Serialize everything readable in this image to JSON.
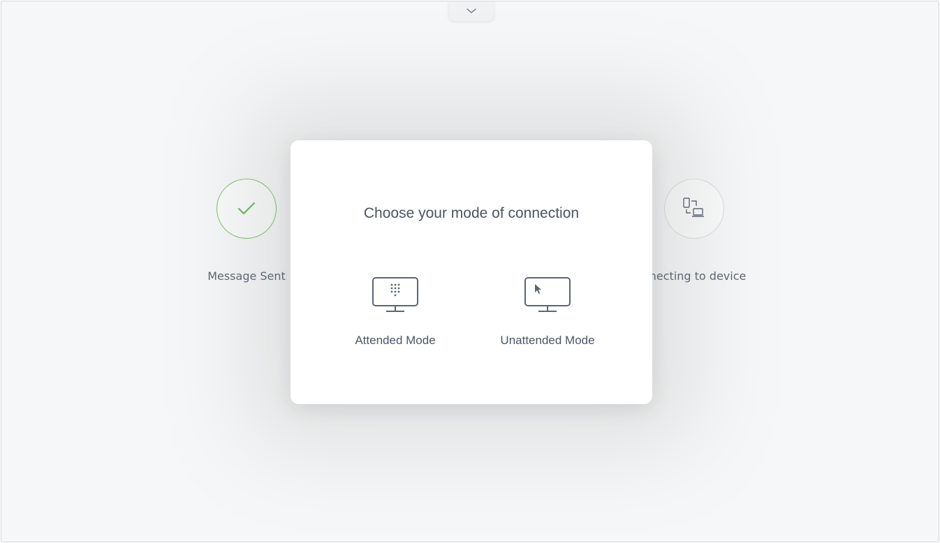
{
  "top_tab": {
    "icon": "chevron-down-icon"
  },
  "steps": [
    {
      "label": "Message Sent",
      "icon": "checkmark-icon",
      "status": "done",
      "color": "#7cc36a"
    },
    {
      "label": "nnecting to device",
      "icon": "devices-icon",
      "status": "pending"
    }
  ],
  "modal": {
    "title": "Choose your mode of connection",
    "options": [
      {
        "label": "Attended Mode",
        "icon": "monitor-keypad-icon"
      },
      {
        "label": "Unattended Mode",
        "icon": "monitor-cursor-icon"
      }
    ]
  },
  "colors": {
    "accent_success": "#7cc36a",
    "text": "#4a5562",
    "icon": "#5b6675"
  }
}
